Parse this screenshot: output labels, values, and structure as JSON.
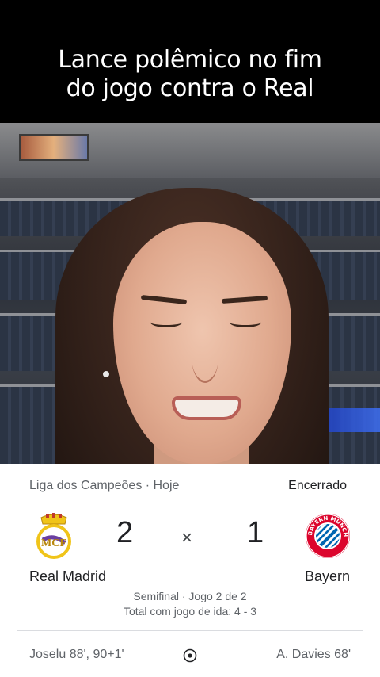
{
  "caption": {
    "line1": "Lance polêmico no fim",
    "line2": "do jogo contra o Real"
  },
  "match_card": {
    "competition": "Liga dos Campeões · Hoje",
    "status": "Encerrado",
    "home": {
      "team": "Real Madrid",
      "score": "2",
      "crest_icon": "real-madrid-crest-icon",
      "scorers": "Joselu 88', 90+1'"
    },
    "separator": "×",
    "away": {
      "team": "Bayern",
      "score": "1",
      "crest_icon": "bayern-crest-icon",
      "scorers": "A. Davies 68'",
      "crest_text": "FC BAYERN MÜNCHEN"
    },
    "stage": "Semifinal · Jogo 2 de 2",
    "aggregate": "Total com jogo de ida: 4 - 3",
    "goal_icon": "soccer-ball-icon"
  },
  "colors": {
    "card_bg": "#ffffff",
    "text_primary": "#202124",
    "text_secondary": "#5f6368",
    "bayern_red": "#dc052d",
    "bayern_blue": "#0066b2",
    "real_gold": "#f0c419"
  }
}
